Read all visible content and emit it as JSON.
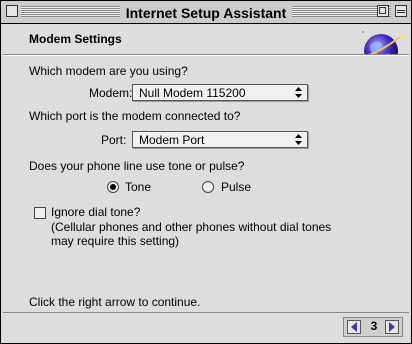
{
  "window": {
    "title": "Internet Setup Assistant"
  },
  "header": {
    "section_title": "Modem Settings",
    "logo_icon": "globe-icon"
  },
  "modem": {
    "question": "Which modem are you using?",
    "label": "Modem:",
    "selected": "Null Modem 115200"
  },
  "port": {
    "question": "Which port is the modem connected to?",
    "label": "Port:",
    "selected": "Modem Port"
  },
  "dialing": {
    "question": "Does your phone line use tone or pulse?",
    "options": [
      {
        "label": "Tone",
        "selected": true
      },
      {
        "label": "Pulse",
        "selected": false
      }
    ]
  },
  "dial_tone": {
    "label": "Ignore dial tone?",
    "checked": false,
    "note_line1": "(Cellular phones and other phones without dial tones",
    "note_line2": "may require this setting)"
  },
  "footer": {
    "instruction": "Click the right arrow to continue.",
    "page_number": "3",
    "prev_icon": "left-arrow-icon",
    "next_icon": "right-arrow-icon"
  }
}
